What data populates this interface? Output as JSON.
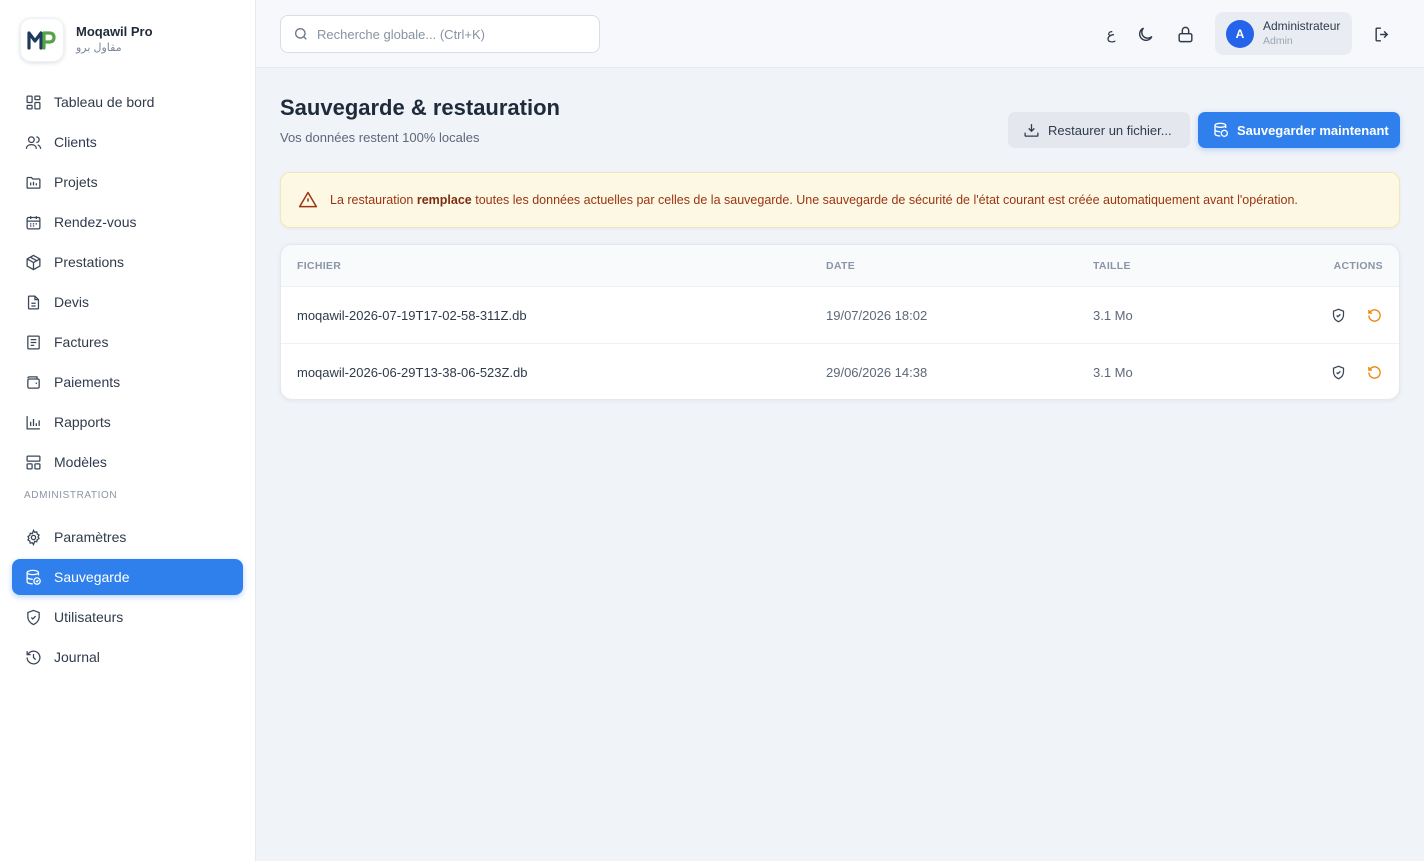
{
  "brand": {
    "name": "Moqawil Pro",
    "subtitle": "مقاول برو",
    "logo_text": "MP"
  },
  "sidebar": {
    "items": [
      {
        "label": "Tableau de bord",
        "icon": "grid-icon"
      },
      {
        "label": "Clients",
        "icon": "users-icon"
      },
      {
        "label": "Projets",
        "icon": "folder-icon"
      },
      {
        "label": "Rendez-vous",
        "icon": "calendar-icon"
      },
      {
        "label": "Prestations",
        "icon": "box-icon"
      },
      {
        "label": "Devis",
        "icon": "document-icon"
      },
      {
        "label": "Factures",
        "icon": "receipt-icon"
      },
      {
        "label": "Paiements",
        "icon": "wallet-icon"
      },
      {
        "label": "Rapports",
        "icon": "bar-chart-icon"
      },
      {
        "label": "Modèles",
        "icon": "template-icon"
      }
    ],
    "admin_section_label": "ADMINISTRATION",
    "admin_items": [
      {
        "label": "Paramètres",
        "icon": "gear-icon"
      },
      {
        "label": "Sauvegarde",
        "icon": "database-backup-icon",
        "active": true
      },
      {
        "label": "Utilisateurs",
        "icon": "shield-icon"
      },
      {
        "label": "Journal",
        "icon": "history-icon"
      }
    ]
  },
  "topbar": {
    "search_placeholder": "Recherche globale... (Ctrl+K)",
    "lang_toggle": "ع",
    "user": {
      "initial": "A",
      "name": "Administrateur",
      "role": "Admin"
    }
  },
  "page": {
    "title": "Sauvegarde & restauration",
    "subtitle": "Vos données restent 100% locales",
    "restore_button": "Restaurer un fichier...",
    "backup_button": "Sauvegarder maintenant"
  },
  "alert": {
    "prefix": "La restauration ",
    "bold": "remplace",
    "suffix": " toutes les données actuelles par celles de la sauvegarde. Une sauvegarde de sécurité de l'état courant est créée automatiquement avant l'opération."
  },
  "table": {
    "headers": {
      "file": "FICHIER",
      "date": "DATE",
      "size": "TAILLE",
      "actions": "ACTIONS"
    },
    "rows": [
      {
        "file": "moqawil-2026-07-19T17-02-58-311Z.db",
        "date": "19/07/2026 18:02",
        "size": "3.1 Mo"
      },
      {
        "file": "moqawil-2026-06-29T13-38-06-523Z.db",
        "date": "29/06/2026 14:38",
        "size": "3.1 Mo"
      }
    ]
  },
  "colors": {
    "accent": "#2f80ed",
    "warning_bg": "#fdf8e4",
    "warning_text": "#9a3412",
    "restore_icon": "#ea8a0c"
  }
}
